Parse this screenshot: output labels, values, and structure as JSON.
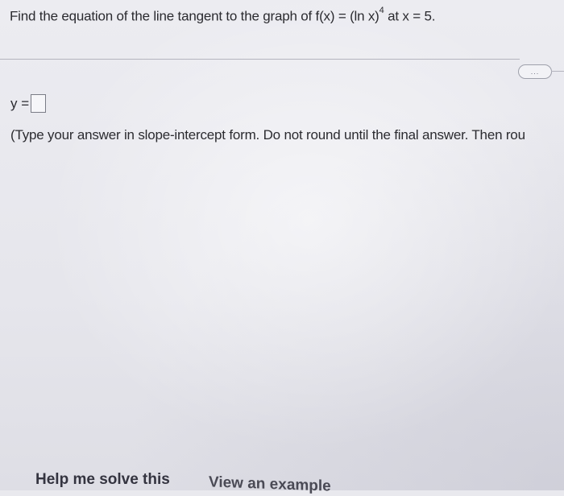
{
  "question": {
    "prefix": "Find the equation of the line tangent to the graph of f(x) = (ln x)",
    "exponent": "4",
    "suffix": " at x = 5."
  },
  "toolbar": {
    "more_label": "..."
  },
  "answer": {
    "label": "y ="
  },
  "instructions": "(Type your answer in slope-intercept form. Do not round until the final answer. Then rou",
  "actions": {
    "help_label": "Help me solve this",
    "example_label": "View an example"
  }
}
